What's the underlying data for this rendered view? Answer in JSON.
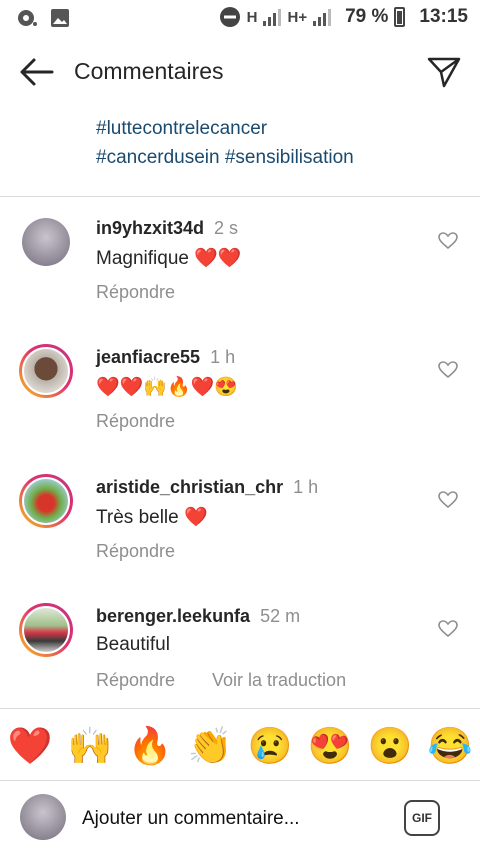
{
  "status_bar": {
    "network1": "H",
    "network2": "H+",
    "battery": "79 %",
    "time": "13:15"
  },
  "header": {
    "title": "Commentaires"
  },
  "caption": {
    "line1": "#luttecontrelecancer",
    "line2": "#cancerdusein #sensibilisation"
  },
  "comments": [
    {
      "username": "in9yhzxit34d",
      "time": "2 s",
      "text": "Magnifique ❤️❤️",
      "reply": "Répondre"
    },
    {
      "username": "jeanfiacre55",
      "time": "1 h",
      "text": "❤️❤️🙌🔥❤️😍",
      "reply": "Répondre"
    },
    {
      "username": "aristide_christian_chr",
      "time": "1 h",
      "text": "Très belle ❤️",
      "reply": "Répondre"
    },
    {
      "username": "berenger.leekunfa",
      "time": "52 m",
      "text": "Beautiful",
      "reply": "Répondre",
      "translate": "Voir la traduction"
    }
  ],
  "reactions": [
    "❤️",
    "🙌",
    "🔥",
    "👏",
    "😢",
    "😍",
    "😮",
    "😂"
  ],
  "input": {
    "placeholder": "Ajouter un commentaire...",
    "gif_label": "GIF"
  }
}
